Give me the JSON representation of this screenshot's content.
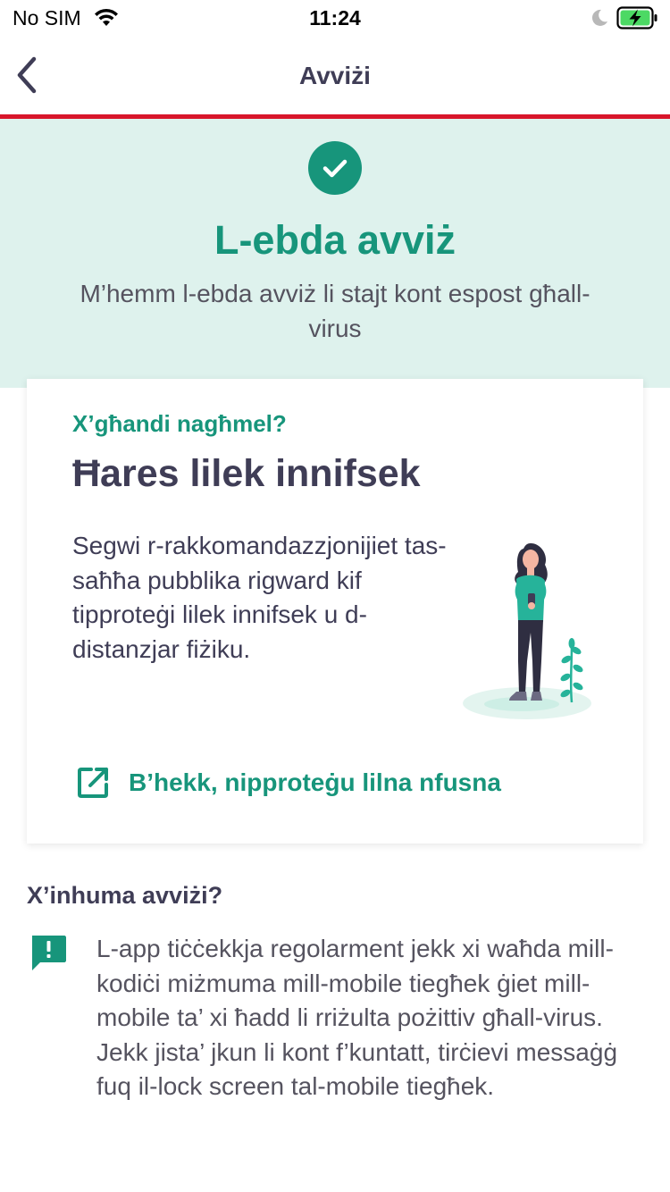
{
  "status_bar": {
    "carrier": "No SIM",
    "time": "11:24",
    "icons": [
      "wifi-icon",
      "moon-icon",
      "battery-charging-icon"
    ]
  },
  "nav": {
    "title": "Avviżi",
    "back_icon": "chevron-left-icon"
  },
  "hero": {
    "icon": "check-circle-icon",
    "title": "L-ebda avviż",
    "subtitle": "M’hemm l-ebda avviż li stajt kont espost għall-virus"
  },
  "card": {
    "eyebrow": "X’għandi nagħmel?",
    "heading": "Ħares lilek innifsek",
    "body": "Segwi r-rakkomandazzjonijiet tas-saħħa pubblika rigward kif tipproteġi lilek innifsek u d-distanzjar fiżiku.",
    "link_label": "B’hekk, nipproteġu lilna nfusna",
    "link_icon": "external-link-icon"
  },
  "info": {
    "heading": "X’inhuma avviżi?",
    "icon": "alert-message-icon",
    "body": "L-app tiċċekkja regolarment jekk xi waħda mill-kodiċi miżmuma mill-mobile tiegħek ġiet mill-mobile ta’ xi ħadd li rriżulta pożittiv għall-virus.  Jekk jista’ jkun li kont f’kuntatt, tirċievi messaġġ fuq il-lock screen tal-mobile tiegħek."
  },
  "colors": {
    "accent": "#17957b",
    "hero_bg": "#def2ed",
    "divider": "#d8162b",
    "text": "#3f3d56"
  }
}
